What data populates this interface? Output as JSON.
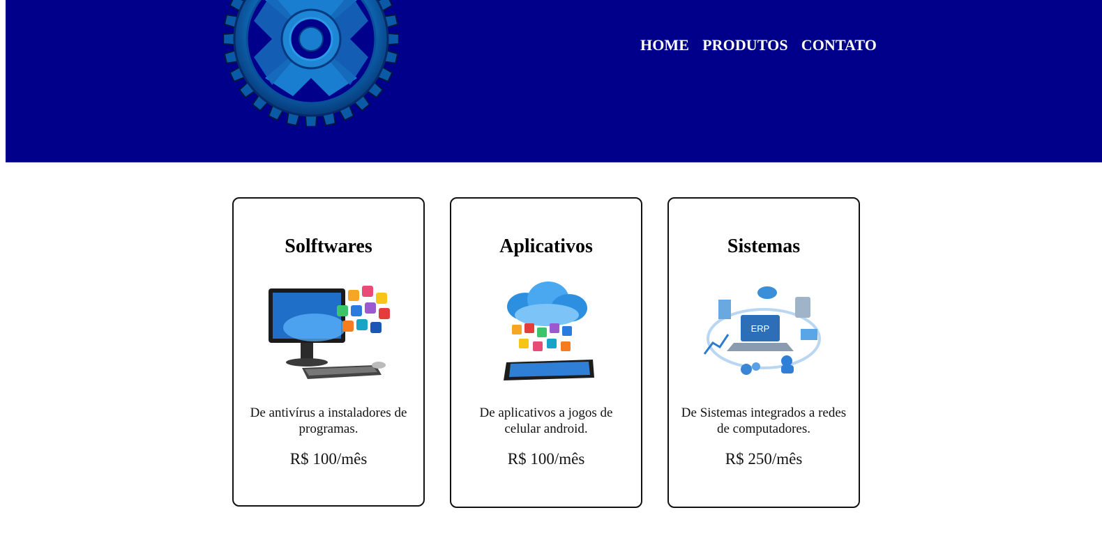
{
  "header": {
    "background": "#00008b",
    "logo_icon": "gear-icon",
    "nav": [
      {
        "label": "HOME"
      },
      {
        "label": "PRODUTOS"
      },
      {
        "label": "CONTATO"
      }
    ]
  },
  "products": [
    {
      "title": "Solftwares",
      "image_icon": "computer-apps-icon",
      "description": "De antivírus a instaladores de programas.",
      "price": "R$ 100/mês"
    },
    {
      "title": "Aplicativos",
      "image_icon": "cloud-phone-apps-icon",
      "description": "De aplicativos a jogos de celular android.",
      "price": "R$ 100/mês"
    },
    {
      "title": "Sistemas",
      "image_icon": "erp-laptop-icon",
      "description": "De Sistemas integrados a redes de computadores.",
      "price": "R$ 250/mês"
    }
  ]
}
